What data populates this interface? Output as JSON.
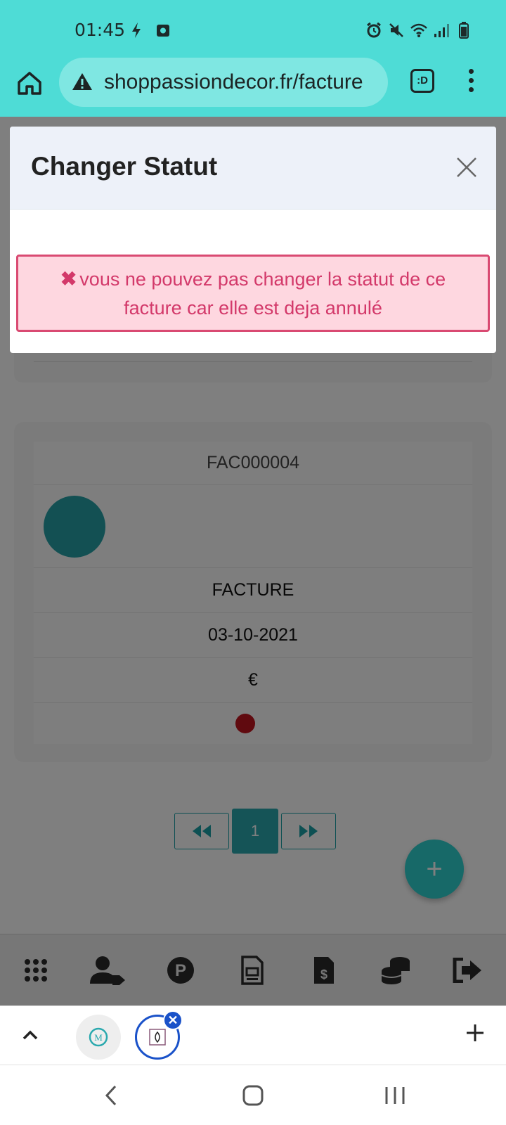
{
  "status_bar": {
    "time": "01:45",
    "icons": [
      "lightning-icon",
      "camera-icon",
      "alarm-icon",
      "mute-icon",
      "wifi-icon",
      "signal-icon",
      "battery-icon"
    ]
  },
  "browser": {
    "url": "shoppassiondecor.fr/facture",
    "tab_switcher_label": ":D"
  },
  "modal": {
    "title": "Changer Statut",
    "alert_message": "vous ne pouvez pas changer la statut de ce facture car elle est deja annulé",
    "alert_symbol": "✖"
  },
  "invoice": {
    "number": "FAC000004",
    "type": "FACTURE",
    "date": "03-10-2021",
    "amount": "€",
    "status_color": "#c0141e"
  },
  "pagination": {
    "current_page": "1"
  },
  "fab_label": "+",
  "bottom_nav": {
    "items": [
      "grid-icon",
      "user-tag-icon",
      "parking-icon",
      "document-icon",
      "invoice-dollar-icon",
      "coins-icon",
      "logout-icon"
    ]
  },
  "tab_strip": {
    "add_label": "+",
    "close_badge": "✕"
  },
  "colors": {
    "accent": "#4edcd6",
    "teal": "#2aa9ae",
    "alert_border": "#d94a72",
    "alert_bg": "#fed7e0"
  }
}
